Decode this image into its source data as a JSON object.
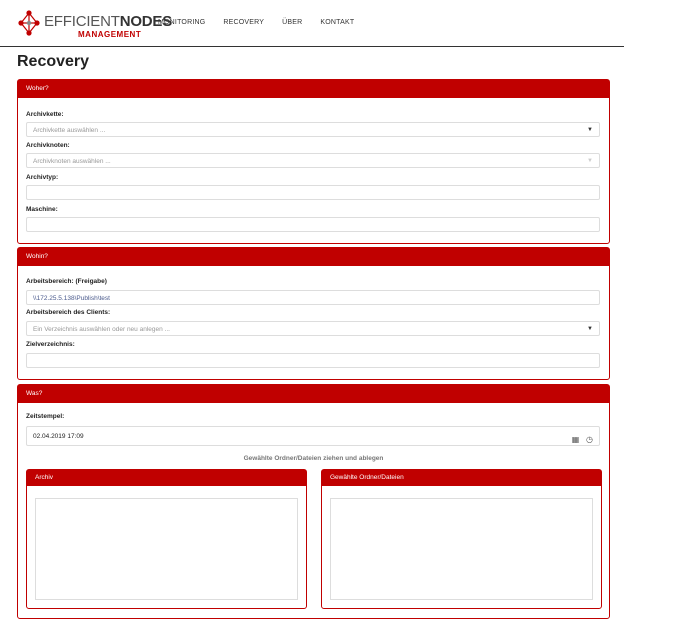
{
  "brand": {
    "name_light": "EFFICIENT",
    "name_bold": "NODES",
    "subtitle": "MANAGEMENT"
  },
  "nav": [
    "MONITORING",
    "RECOVERY",
    "ÜBER",
    "KONTAKT"
  ],
  "page_title": "Recovery",
  "woher": {
    "title": "Woher?",
    "archivkette_label": "Archivkette:",
    "archivkette_placeholder": "Archivkette auswählen ...",
    "archivknoten_label": "Archivknoten:",
    "archivknoten_placeholder": "Archivknoten auswählen ...",
    "archivtyp_label": "Archivtyp:",
    "maschine_label": "Maschine:"
  },
  "wohin": {
    "title": "Wohin?",
    "arbeitsbereich_label": "Arbeitsbereich: (Freigabe)",
    "arbeitsbereich_value": "\\\\172.25.5.138\\Publish\\test",
    "client_label": "Arbeitsbereich des Clients:",
    "client_placeholder": "Ein Verzeichnis auswählen oder neu anlegen ...",
    "ziel_label": "Zielverzeichnis:"
  },
  "was": {
    "title": "Was?",
    "zeitstempel_label": "Zeitstempel:",
    "zeitstempel_value": "02.04.2019 17:09",
    "drag_label": "Gewählte Ordner/Dateien ziehen und ablegen",
    "archiv_title": "Archiv",
    "gewaehlt_title": "Gewählte Ordner/Dateien"
  }
}
